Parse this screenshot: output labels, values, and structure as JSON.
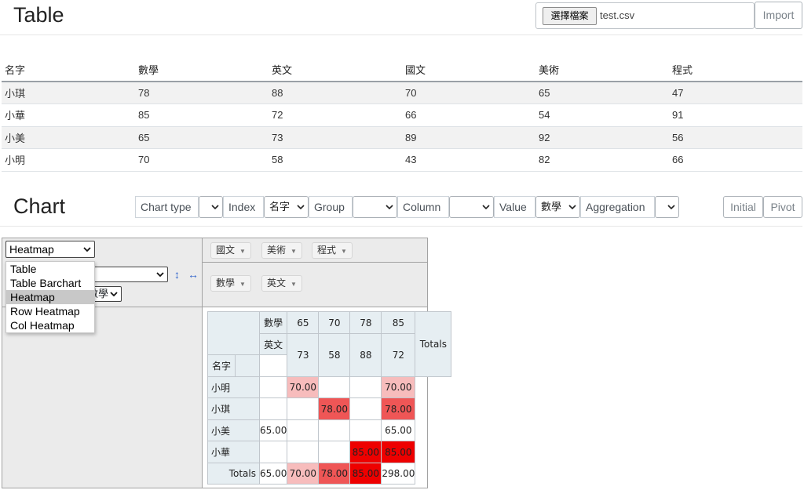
{
  "table_section": {
    "title": "Table",
    "file_button": "選擇檔案",
    "file_name": "test.csv",
    "import_label": "Import",
    "columns": [
      "名字",
      "數學",
      "英文",
      "國文",
      "美術",
      "程式"
    ],
    "rows": [
      [
        "小琪",
        "78",
        "88",
        "70",
        "65",
        "47"
      ],
      [
        "小華",
        "85",
        "72",
        "66",
        "54",
        "91"
      ],
      [
        "小美",
        "65",
        "73",
        "89",
        "92",
        "56"
      ],
      [
        "小明",
        "70",
        "58",
        "43",
        "82",
        "66"
      ]
    ]
  },
  "chart_section": {
    "title": "Chart",
    "labels": {
      "chart_type": "Chart type",
      "index": "Index",
      "group": "Group",
      "column": "Column",
      "value": "Value",
      "aggregation": "Aggregation"
    },
    "index_value": "名字",
    "value_value": "數學",
    "initial_label": "Initial",
    "pivot_label": "Pivot"
  },
  "pivot": {
    "renderer_selected": "Heatmap",
    "renderer_options": [
      "Table",
      "Table Barchart",
      "Heatmap",
      "Row Heatmap",
      "Col Heatmap"
    ],
    "value_field_partial": "數學",
    "sort_row_icon": "↕",
    "sort_col_icon": "↔",
    "unused_attrs": [
      "國文",
      "美術",
      "程式"
    ],
    "col_attrs": [
      "數學",
      "英文"
    ],
    "row_attr": "名字",
    "col_header_1": [
      "65",
      "70",
      "78",
      "85"
    ],
    "col_header_2": [
      "73",
      "58",
      "88",
      "72"
    ],
    "totals_label": "Totals",
    "rows": [
      {
        "name": "小明",
        "cells": [
          "",
          "70.00",
          "",
          ""
        ],
        "total": "70.00"
      },
      {
        "name": "小琪",
        "cells": [
          "",
          "",
          "78.00",
          ""
        ],
        "total": "78.00"
      },
      {
        "name": "小美",
        "cells": [
          "65.00",
          "",
          "",
          ""
        ],
        "total": "65.00"
      },
      {
        "name": "小華",
        "cells": [
          "",
          "",
          "",
          "85.00"
        ],
        "total": "85.00"
      }
    ],
    "col_totals": [
      "65.00",
      "70.00",
      "78.00",
      "85.00"
    ],
    "grand_total": "298.00",
    "heat_colors": {
      "65": "#ffffff",
      "70": "#f7bcbc",
      "78": "#ef5656",
      "85": "#ee0000"
    }
  }
}
